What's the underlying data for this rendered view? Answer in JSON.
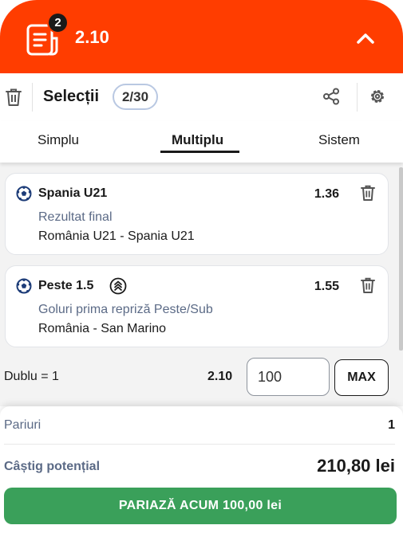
{
  "header": {
    "badge_count": "2",
    "total_odds": "2.10",
    "icons": {
      "slip": "bet-slip-icon",
      "collapse": "chevron-up-icon"
    },
    "accent_color": "#ff3d00"
  },
  "toolbar": {
    "title": "Selecții",
    "count": "2/30",
    "icons": {
      "clear": "trash-icon",
      "share": "share-icon",
      "settings": "gear-icon"
    }
  },
  "tabs": [
    {
      "label": "Simplu",
      "active": false
    },
    {
      "label": "Multiplu",
      "active": true
    },
    {
      "label": "Sistem",
      "active": false
    }
  ],
  "selections": [
    {
      "name": "Spania U21",
      "odds": "1.36",
      "market": "Rezultat final",
      "event": "România U21 - Spania U21",
      "icon": "soccer-ball-icon"
    },
    {
      "name": "Peste 1.5",
      "odds": "1.55",
      "market": "Goluri prima repriză Peste/Sub",
      "event": "România - San Marino",
      "icon": "soccer-ball-icon",
      "extra_icon": "boost-icon"
    }
  ],
  "combo": {
    "label": "Dublu = 1",
    "odds": "2.10",
    "stake": "100",
    "max_label": "MAX"
  },
  "summary": {
    "bets_label": "Pariuri",
    "bets_value": "1",
    "win_label": "Câștig potențial",
    "win_value": "210,80 lei",
    "place_bet_label": "PARIAZĂ ACUM 100,00 lei",
    "button_color": "#3aa05a"
  }
}
